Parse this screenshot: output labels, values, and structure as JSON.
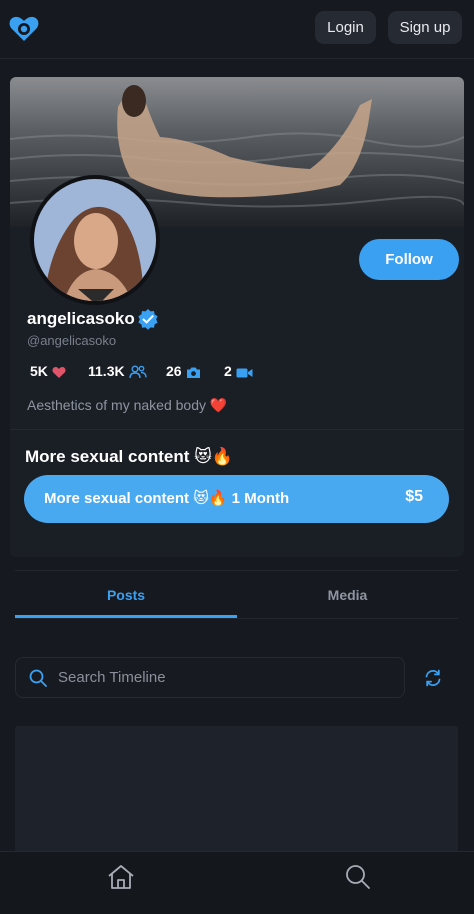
{
  "header": {
    "login_label": "Login",
    "signup_label": "Sign up"
  },
  "profile": {
    "follow_label": "Follow",
    "name": "angelicasoko",
    "handle": "@angelicasoko",
    "bio": "Aesthetics of my naked body ❤️",
    "stats": [
      {
        "value": "5K",
        "icon": "heart-icon"
      },
      {
        "value": "11.3K",
        "icon": "users-icon"
      },
      {
        "value": "26",
        "icon": "camera-icon"
      },
      {
        "value": "2",
        "icon": "video-icon"
      }
    ]
  },
  "subscription": {
    "section_title": "More sexual content 😻🔥",
    "button_label": "More sexual content 😻🔥  1 Month",
    "price": "$5"
  },
  "tabs": [
    {
      "label": "Posts",
      "active": true
    },
    {
      "label": "Media",
      "active": false
    }
  ],
  "search": {
    "placeholder": "Search Timeline"
  },
  "bottom_nav": [
    {
      "icon": "home-icon"
    },
    {
      "icon": "search-icon"
    }
  ],
  "colors": {
    "accent": "#3aa0f2",
    "background": "#16191f",
    "heart": "#e0546a"
  }
}
